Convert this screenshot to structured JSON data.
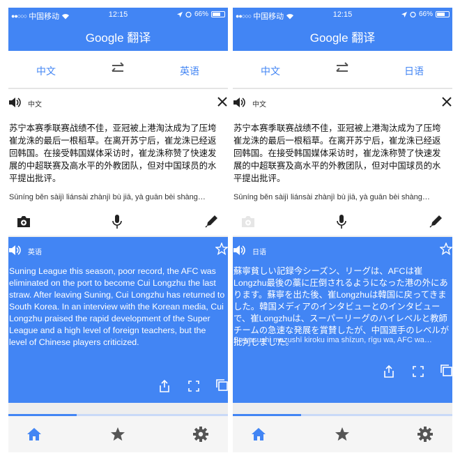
{
  "status_bar": {
    "carrier": "中国移动",
    "time": "12:15",
    "battery": "66%"
  },
  "app_title": "Google 翻译",
  "source_language": "中文",
  "source_card_label": "中文",
  "source_text": "苏宁本赛季联赛战绩不佳，亚冠被上港淘汰成为了压垮崔龙洙的最后一根稻草。在离开苏宁后，崔龙洙已经返回韩国。在接受韩国媒体采访时，崔龙洙称赞了快速发展的中超联赛及高水平的外教团队，但对中国球员的水平提出批评。",
  "source_romanization": "Sūníng běn sàijì liánsài zhànjì bù jiā, yà guān bèi shàng…",
  "left_screen": {
    "target_language": "英语",
    "output_label": "英语",
    "output_text": "Suning League this season, poor record, the AFC was eliminated on the port to become Cui Longzhu the last straw. After leaving Suning, Cui Longzhu has returned to South Korea. In an interview with the Korean media, Cui Longzhu praised the rapid development of the Super League and a high level of foreign teachers, but the level of Chinese players criticized.",
    "progress_fraction": 0.31
  },
  "right_screen": {
    "target_language": "日语",
    "output_label": "日语",
    "output_text": "蘇寧貧しい記録今シーズン、リーグは、AFCは崔Longzhu最後の藁に圧倒されるようになった港の外にあります。蘇寧を出た後、崔Longzhuは韓国に戻ってきました。韓国メディアのインタビューとのインタビューで、崔Longzhuは、スーパーリーグのハイレベルと教師チームの急速な発展を賞賛したが、中国選手のレベルが批判しました。",
    "output_romanization": "So yasushi mazushī kiroku ima shīzun, rīgu wa, AFC wa…",
    "progress_fraction": 0.31
  },
  "colors": {
    "primary": "#4285f4",
    "card_bg": "#ffffff",
    "page_bg": "#eeeeee"
  },
  "icons": [
    "speaker-icon",
    "close-icon",
    "camera-icon",
    "mic-icon",
    "pen-icon",
    "star-icon",
    "share-icon",
    "expand-icon",
    "copy-icon",
    "home-icon",
    "gear-icon",
    "swap-icon"
  ]
}
